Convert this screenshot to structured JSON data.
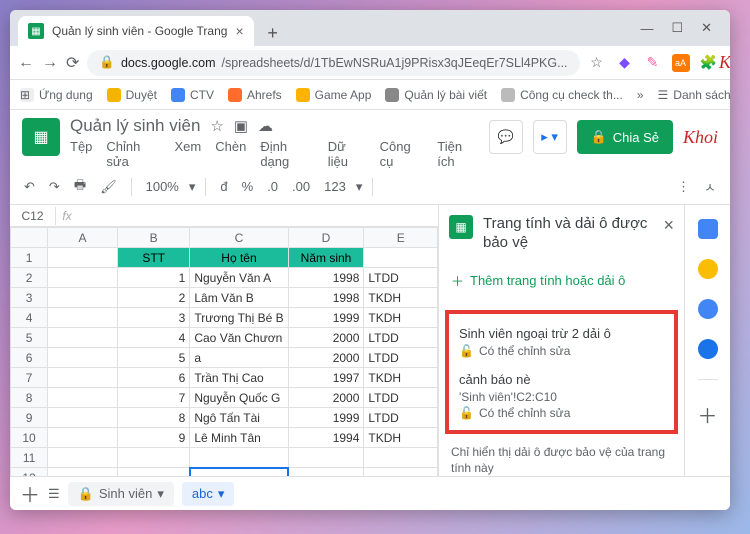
{
  "browser": {
    "tab_title": "Quản lý sinh viên - Google Trang",
    "url_prefix": "docs.google.com",
    "url_rest": "/spreadsheets/d/1TbEwNSRuA1j9PRisx3qJEeqEr7SLl4PKG...",
    "bookmarks": [
      "Ứng dụng",
      "Duyệt",
      "CTV",
      "Ahrefs",
      "Game App",
      "Quản lý bài viết",
      "Công cụ check th...",
      "Danh sách đọc"
    ]
  },
  "doc": {
    "title": "Quản lý sinh viên",
    "menubar": [
      "Tệp",
      "Chỉnh sửa",
      "Xem",
      "Chèn",
      "Định dạng",
      "Dữ liệu",
      "Công cụ",
      "Tiện ích"
    ],
    "share": "Chia Sẻ",
    "avatar": "Khoi",
    "zoom": "100%",
    "currency": "đ",
    "decimals": ".0",
    ".00": ".00",
    "digits": "123"
  },
  "fx": {
    "namebox": "C12"
  },
  "cols": [
    "A",
    "B",
    "C",
    "D",
    "E"
  ],
  "headers": {
    "b": "STT",
    "c": "Họ tên",
    "d": "Năm sinh"
  },
  "rows": [
    {
      "b": "1",
      "c": "Nguyễn Văn A",
      "d": "1998",
      "e": "LTDD"
    },
    {
      "b": "2",
      "c": "Lâm Văn B",
      "d": "1998",
      "e": "TKDH"
    },
    {
      "b": "3",
      "c": "Trương Thị Bé B",
      "d": "1999",
      "e": "TKDH"
    },
    {
      "b": "4",
      "c": "Cao Văn Chươn",
      "d": "2000",
      "e": "LTDD"
    },
    {
      "b": "5",
      "c": "a",
      "d": "2000",
      "e": "LTDD"
    },
    {
      "b": "6",
      "c": "Trần Thị Cao",
      "d": "1997",
      "e": "TKDH"
    },
    {
      "b": "7",
      "c": "Nguyễn Quốc G",
      "d": "2000",
      "e": "LTDD"
    },
    {
      "b": "8",
      "c": "Ngô Tấn Tài",
      "d": "1999",
      "e": "LTDD"
    },
    {
      "b": "9",
      "c": "Lê Minh Tân",
      "d": "1994",
      "e": "TKDH"
    }
  ],
  "panel": {
    "title": "Trang tính và dải ô được bảo vệ",
    "add": "Thêm trang tính hoặc dải ô",
    "ranges": [
      {
        "name": "Sinh viên ngoại trừ 2 dải ô",
        "sub": "",
        "edit": "Có thể chỉnh sửa"
      },
      {
        "name": "cảnh báo nè",
        "sub": "'Sinh viên'!C2:C10",
        "edit": "Có thể chỉnh sửa"
      }
    ],
    "note": "Chỉ hiển thị dải ô được bảo vệ của trang tính này"
  },
  "tabs": {
    "sheet1": "Sinh viên",
    "sheet2": "abc"
  }
}
